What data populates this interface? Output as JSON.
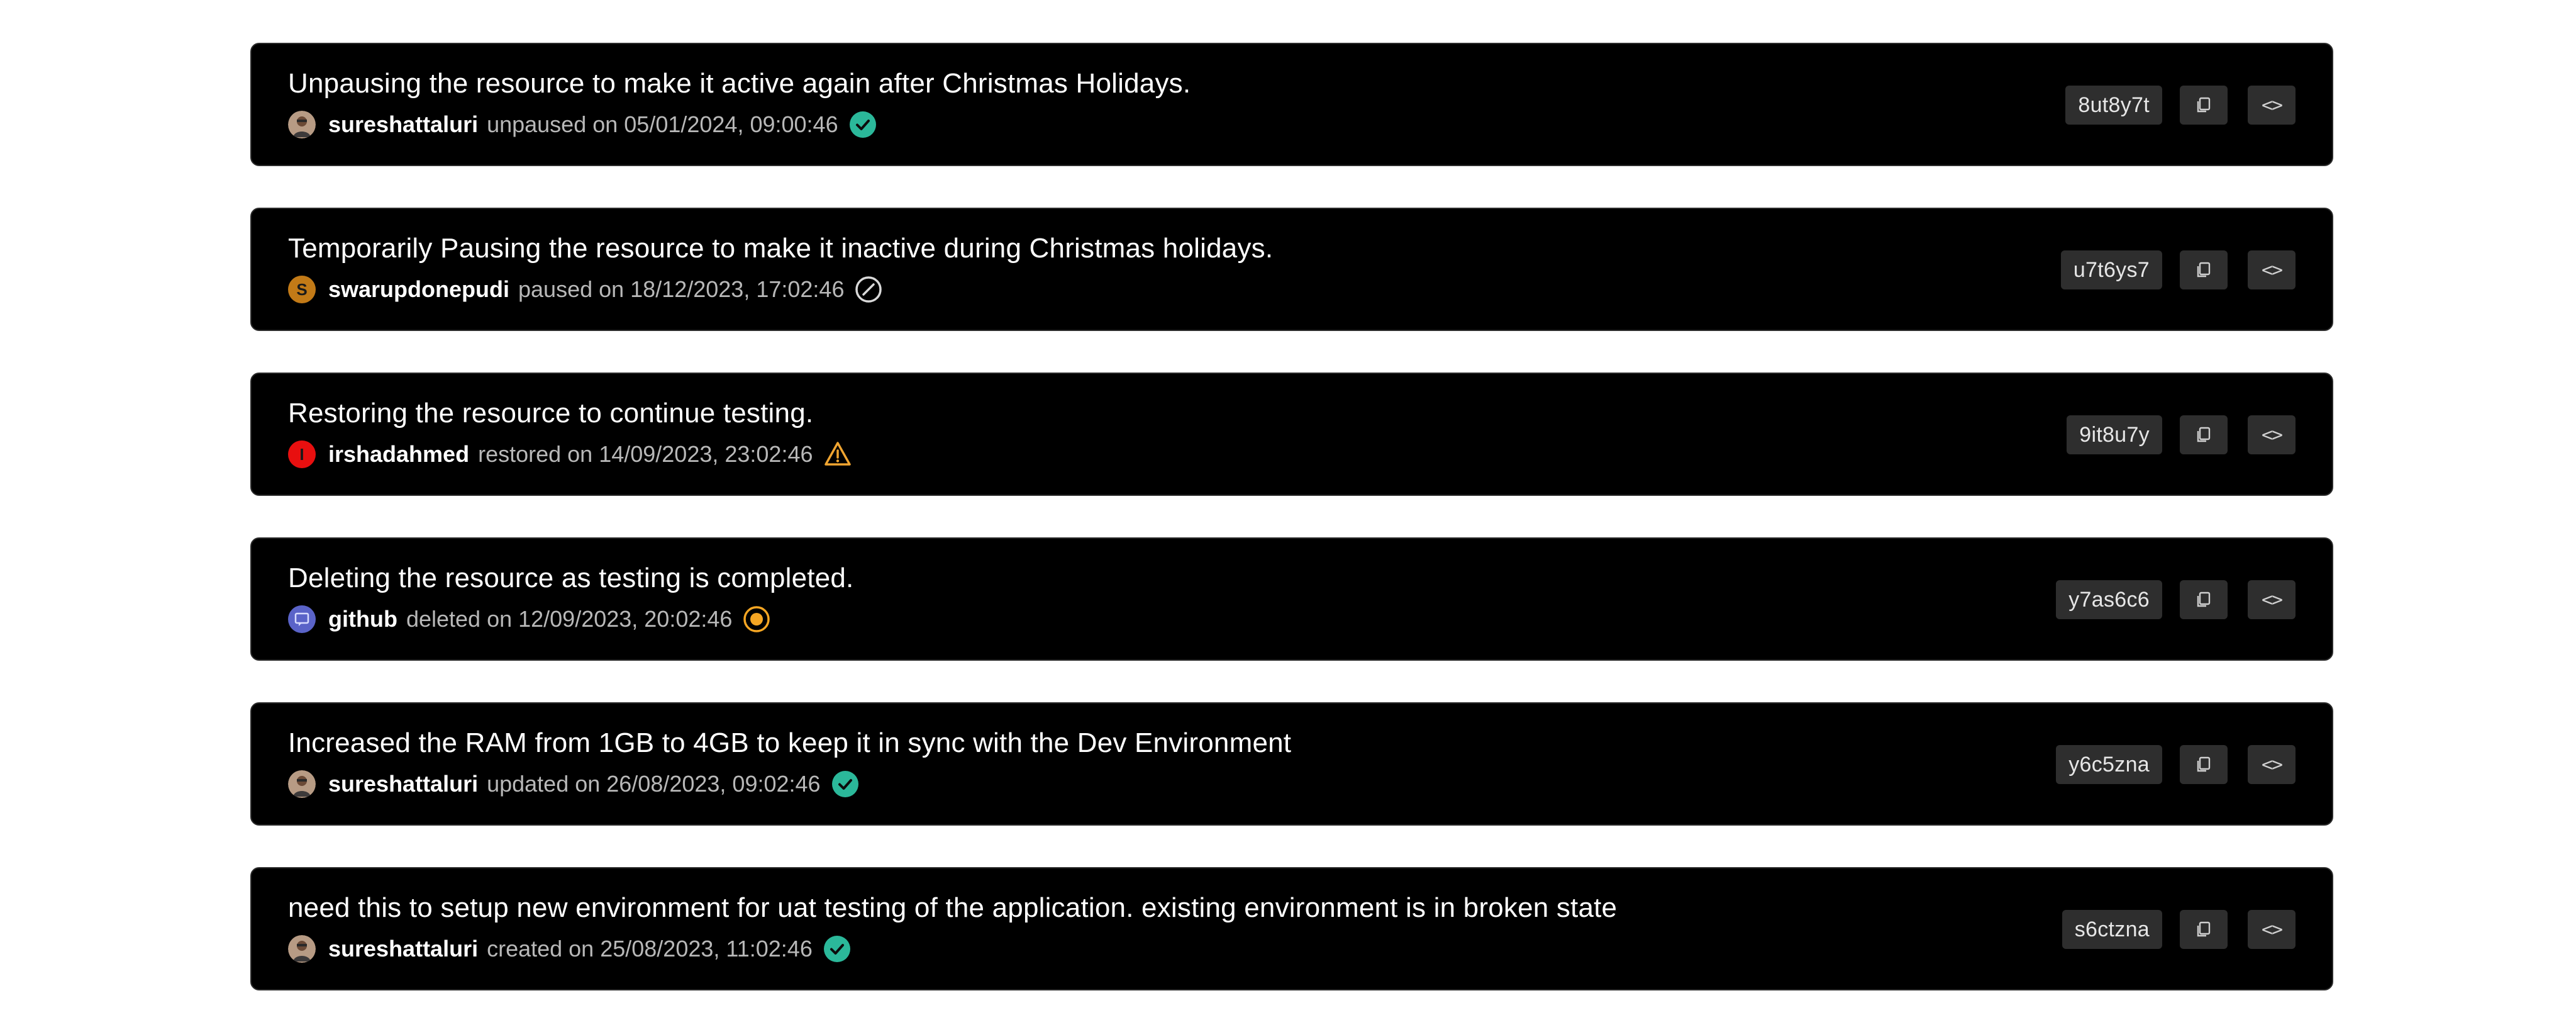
{
  "activity_log": [
    {
      "title": "Unpausing the resource to make it active again after Christmas Holidays.",
      "user": "sureshattaluri",
      "avatar": {
        "type": "photo",
        "initial": "",
        "color": "#8a6a55"
      },
      "action": "unpaused on 05/01/2024, 09:00:46",
      "status_icon": "check-circle-icon",
      "status_color": "#2bb89a",
      "hash": "8ut8y7t",
      "copy_label": "⧉",
      "code_label": "<>"
    },
    {
      "title": "Temporarily Pausing the resource to make it inactive during Christmas holidays.",
      "user": "swarupdonepudi",
      "avatar": {
        "type": "initial",
        "initial": "S",
        "color": "#c27a17"
      },
      "action": "paused on 18/12/2023, 17:02:46",
      "status_icon": "prohibited-circle-icon",
      "status_color": "#d9d9d9",
      "hash": "u7t6ys7",
      "copy_label": "⧉",
      "code_label": "<>"
    },
    {
      "title": "Restoring the resource to continue testing.",
      "user": "irshadahmed",
      "avatar": {
        "type": "initial",
        "initial": "I",
        "color": "#e80f0f"
      },
      "action": "restored on 14/09/2023, 23:02:46",
      "status_icon": "warning-triangle-icon",
      "status_color": "#f0a531",
      "hash": "9it8u7y",
      "copy_label": "⧉",
      "code_label": "<>"
    },
    {
      "title": "Deleting the resource as testing is completed.",
      "user": "github",
      "avatar": {
        "type": "bot",
        "initial": "",
        "color": "#5a63c8"
      },
      "action": "deleted on 12/09/2023, 20:02:46",
      "status_icon": "in-progress-dot-icon",
      "status_color": "#f5a623",
      "hash": "y7as6c6",
      "copy_label": "⧉",
      "code_label": "<>"
    },
    {
      "title": "Increased the RAM from 1GB to 4GB to keep it in sync with the Dev Environment",
      "user": "sureshattaluri",
      "avatar": {
        "type": "photo",
        "initial": "",
        "color": "#8a6a55"
      },
      "action": "updated on 26/08/2023, 09:02:46",
      "status_icon": "check-circle-icon",
      "status_color": "#2bb89a",
      "hash": "y6c5zna",
      "copy_label": "⧉",
      "code_label": "<>"
    },
    {
      "title": "need this to setup new environment for uat testing of the application. existing environment is in broken state",
      "user": "sureshattaluri",
      "avatar": {
        "type": "photo",
        "initial": "",
        "color": "#8a6a55"
      },
      "action": "created on 25/08/2023, 11:02:46",
      "status_icon": "check-circle-icon",
      "status_color": "#2bb89a",
      "hash": "s6ctzna",
      "copy_label": "⧉",
      "code_label": "<>"
    }
  ]
}
